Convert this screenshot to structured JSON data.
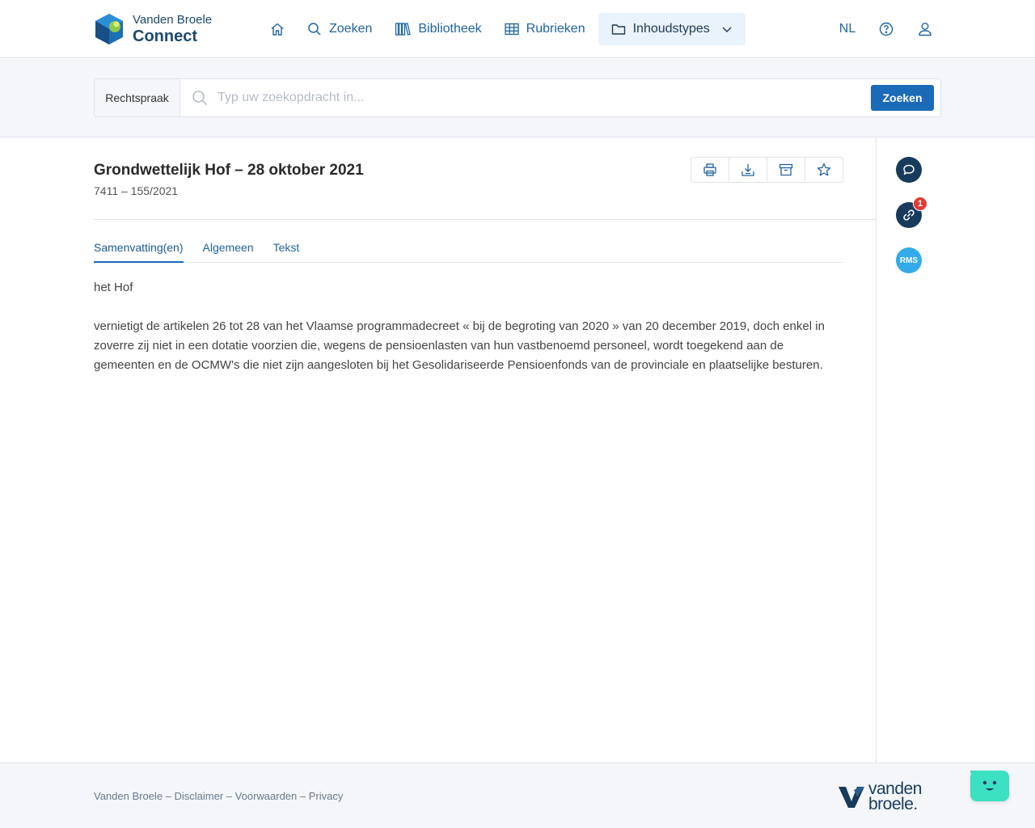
{
  "header": {
    "logo": {
      "line1": "Vanden Broele",
      "line2": "Connect"
    },
    "nav": [
      {
        "label": ""
      },
      {
        "label": "Zoeken"
      },
      {
        "label": "Bibliotheek"
      },
      {
        "label": "Rubrieken"
      },
      {
        "label": "Inhoudstypes"
      }
    ],
    "language": "NL"
  },
  "search": {
    "scope": "Rechtspraak",
    "placeholder": "Typ uw zoekopdracht in...",
    "value": "",
    "button": "Zoeken"
  },
  "document": {
    "title": "Grondwettelijk Hof – 28 oktober 2021",
    "subtitle": "7411 – 155/2021",
    "tabs": [
      {
        "label": "Samenvatting(en)"
      },
      {
        "label": "Algemeen"
      },
      {
        "label": "Tekst"
      }
    ],
    "paragraphs": [
      "het Hof",
      "vernietigt de artikelen 26 tot 28 van het Vlaamse programmadecreet « bij de begroting van 2020 » van 20 december 2019, doch enkel in zoverre zij niet in een dotatie voorzien die, wegens de pensioenlasten van hun vastbenoemd personeel, wordt toegekend aan de gemeenten en de OCMW's die niet zijn aangesloten bij het Gesolidariseerde Pensioenfonds van de provinciale en plaatselijke besturen."
    ]
  },
  "side": {
    "links_badge": "1",
    "rms_label": "RMS"
  },
  "footer": {
    "links": [
      "Vanden Broele",
      "Disclaimer",
      "Voorwaarden",
      "Privacy"
    ],
    "separator": " – ",
    "brand_line1": "vanden",
    "brand_line2": "broele."
  },
  "colors": {
    "accent": "#1a6ab8",
    "navy": "#173b5c",
    "rms": "#33aaea",
    "badge": "#e53935",
    "chatbot": "#3ce0c3"
  },
  "icons": [
    "home-icon",
    "search-icon",
    "library-icon",
    "grid-icon",
    "folder-icon",
    "chevron-down-icon",
    "help-icon",
    "user-icon",
    "print-icon",
    "download-icon",
    "archive-icon",
    "star-icon",
    "comment-icon",
    "link-icon",
    "chatbot-icon"
  ]
}
